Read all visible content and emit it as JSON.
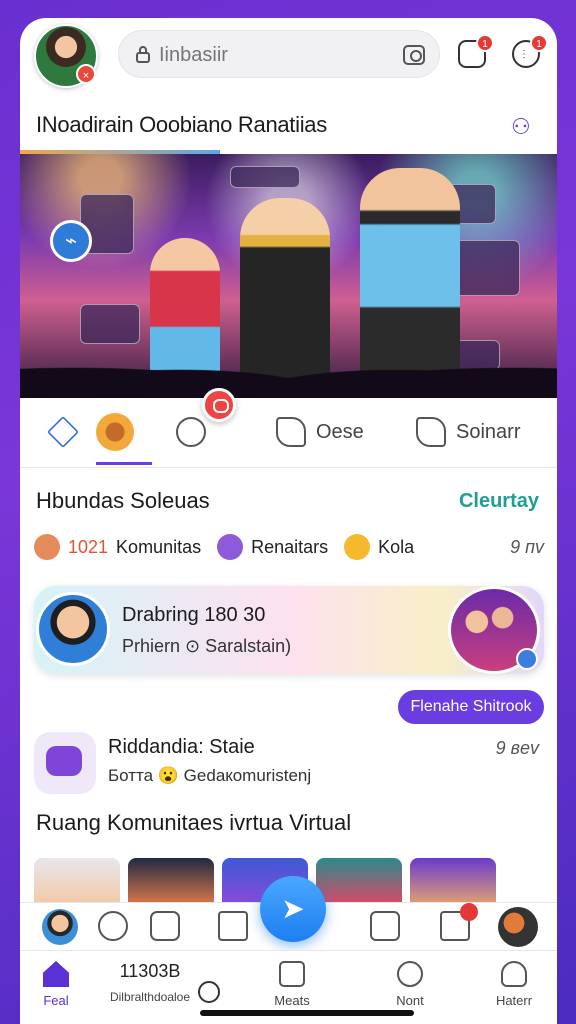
{
  "header": {
    "search_placeholder": "Iinbasiir",
    "avatar_badge": "×",
    "msg_badge": "1",
    "more_badge": "1"
  },
  "title": "INoadirain Ooobiano Ranatiias",
  "tabs": [
    {
      "label": ""
    },
    {
      "label": ""
    },
    {
      "label": ""
    },
    {
      "label": "Oese"
    },
    {
      "label": "Soinarr"
    }
  ],
  "section1": {
    "title": "Hbundas Soleuas",
    "link": "Cleurtay",
    "stats": {
      "count": "1021",
      "communities": "Komunitas",
      "renaitars": "Renaitars",
      "kola": "Kola",
      "age": "9 пv"
    }
  },
  "card": {
    "title": "Drabring 180 30",
    "subtitle": "Prhiern ⊙ Saralstain)"
  },
  "pill_button": "Flenahe Shitrook",
  "post": {
    "title": "Riddandia: Staie",
    "subtitle": "Ботта 😮 Gedaкomuristenj",
    "time": "9 вev"
  },
  "section2": {
    "title": "Ruang Komunitaes ivrtua Virtual"
  },
  "bottom_nav": {
    "feed": "Feal",
    "dir_top": "11303B",
    "dir": "Dilbralthdoaloe",
    "meets": "Meats",
    "nont": "Nont",
    "lat": "Haterr"
  },
  "colors": {
    "accent": "#6a3de0",
    "link": "#1e9e95",
    "fab": "#1e7ff0",
    "badge": "#e53935"
  }
}
